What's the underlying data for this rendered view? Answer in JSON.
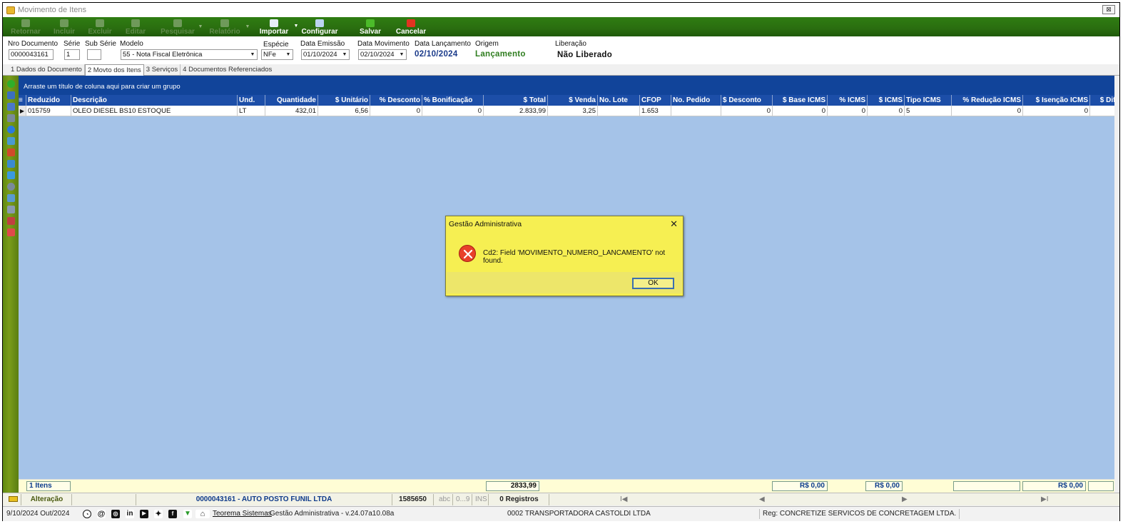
{
  "window": {
    "title": "Movimento de Itens",
    "close_label": "⊠"
  },
  "toolbar": {
    "items": [
      {
        "label": "Retornar",
        "enabled": false
      },
      {
        "label": "Incluir",
        "enabled": false
      },
      {
        "label": "Excluir",
        "enabled": false
      },
      {
        "label": "Editar",
        "enabled": false
      },
      {
        "label": "Pesquisar",
        "enabled": false
      },
      {
        "label": "Relatório",
        "enabled": false
      },
      {
        "label": "Importar",
        "enabled": true
      },
      {
        "label": "Configurar",
        "enabled": true
      },
      {
        "label": "Salvar",
        "enabled": true
      },
      {
        "label": "Cancelar",
        "enabled": true
      }
    ]
  },
  "header": {
    "nro_documento": {
      "label": "Nro Documento",
      "value": "0000043161"
    },
    "serie": {
      "label": "Série",
      "value": "1"
    },
    "sub_serie": {
      "label": "Sub Série",
      "value": ""
    },
    "modelo": {
      "label": "Modelo",
      "value": "55 - Nota Fiscal Eletrônica"
    },
    "especie": {
      "label": "Espécie",
      "value": "NFe"
    },
    "data_emissao": {
      "label": "Data Emissão",
      "value": "01/10/2024"
    },
    "data_movimento": {
      "label": "Data Movimento",
      "value": "02/10/2024"
    },
    "data_lancamento": {
      "label": "Data Lançamento",
      "value": "02/10/2024"
    },
    "origem": {
      "label": "Origem",
      "value": "Lançamento"
    },
    "liberacao": {
      "label": "Liberação",
      "value": "Não Liberado"
    }
  },
  "tabs": [
    {
      "label": "1 Dados do Documento",
      "active": false
    },
    {
      "label": "2 Movto dos Itens",
      "active": true
    },
    {
      "label": "3 Serviços",
      "active": false
    },
    {
      "label": "4 Documentos Referenciados",
      "active": false
    }
  ],
  "grid": {
    "group_hint": "Arraste um título de coluna aqui para criar um grupo",
    "columns": [
      "Reduzido",
      "Descrição",
      "Und.",
      "Quantidade",
      "$ Unitário",
      "% Desconto",
      "% Bonificação",
      "$ Total",
      "$ Venda",
      "No. Lote",
      "CFOP",
      "No. Pedido",
      "$ Desconto",
      "$ Base ICMS",
      "% ICMS",
      "$ ICMS",
      "Tipo ICMS",
      "% Redução ICMS",
      "$ Isenção ICMS",
      "$ Dife"
    ],
    "rows": [
      [
        "015759",
        "OLEO DIESEL BS10 ESTOQUE",
        "LT",
        "432,01",
        "6,56",
        "0",
        "0",
        "2.833,99",
        "3,25",
        "",
        "1.653",
        "",
        "0",
        "0",
        "0",
        "0",
        "5",
        "0",
        "0",
        ""
      ]
    ]
  },
  "totals": {
    "itens": "1 Itens",
    "total": "2833,99",
    "base_icms": "R$ 0,00",
    "icms": "R$ 0,00",
    "isencao": "R$ 0,00"
  },
  "status_bar": {
    "mode": "Alteração",
    "document": "0000043161 - AUTO POSTO FUNIL LTDA",
    "code": "1585650",
    "abc": "abc",
    "num": "0...9",
    "ins": "INS",
    "registros": "0 Registros",
    "nav_first": "I◀",
    "nav_prev": "◀",
    "nav_next": "▶",
    "nav_last": "▶I"
  },
  "footer": {
    "date": "9/10/2024 Out/2024",
    "company_link": "Teorema Sistemas",
    "version": "Gestão Administrativa - v.24.07a10.08a",
    "branch": "0002 TRANSPORTADORA CASTOLDI LTDA",
    "reg": "Reg: CONCRETIZE SERVICOS DE CONCRETAGEM LTDA."
  },
  "dialog": {
    "title": "Gestão Administrativa",
    "close": "✕",
    "message": "Cd2: Field 'MOVIMENTO_NUMERO_LANCAMENTO' not found.",
    "ok_label": "OK"
  },
  "colors": {
    "toolbar": "#2a6d10",
    "grid_header": "#1c4ea8",
    "grid_bg": "#a5c3e8",
    "dialog_bg": "#f6ef52",
    "origem_text": "#2e7d1e",
    "date_text": "#1a3a8a"
  }
}
